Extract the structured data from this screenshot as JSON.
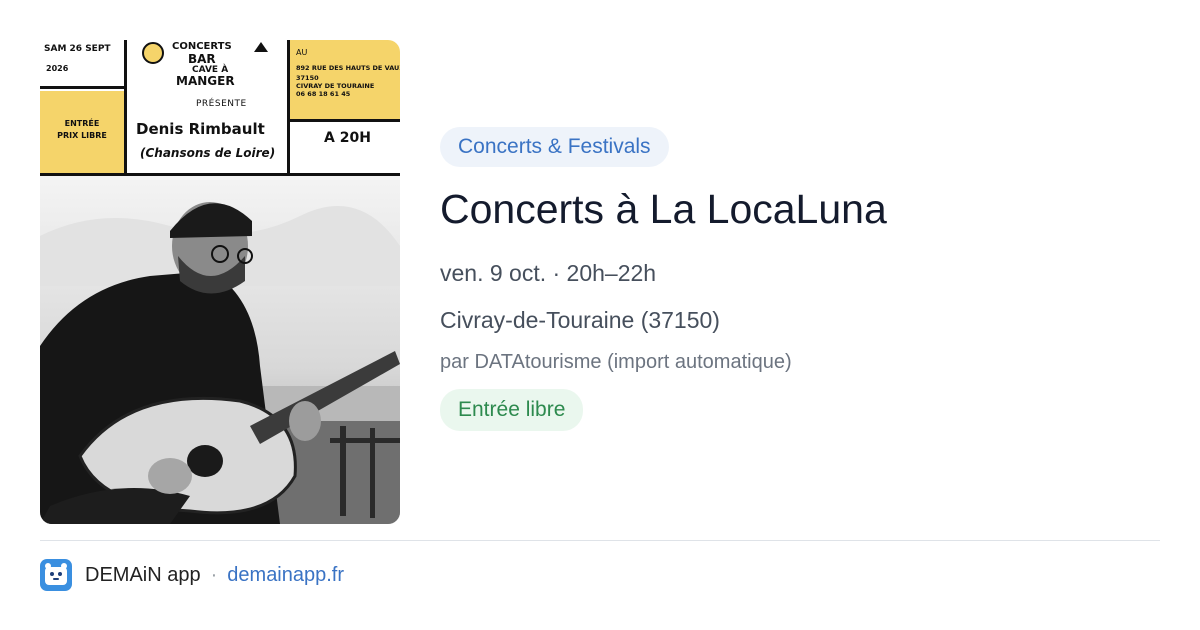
{
  "event_card": {
    "category": "Concerts & Festivals",
    "title": "Concerts à La LocaLuna",
    "datetime": "ven. 9 oct. · 20h–22h",
    "location": "Civray-de-Touraine (37150)",
    "source": "par DATAtourisme (import automatique)",
    "price": "Entrée libre"
  },
  "poster": {
    "date_line1": "SAM 26 SEPT",
    "date_line2": "2026",
    "logo_line1": "CONCERTS",
    "logo_line2": "BAR",
    "logo_line3": "CAVE À",
    "logo_line4": "MANGER",
    "presents": "PRÉSENTE",
    "artist": "Denis Rimbault",
    "subtitle": "(Chansons de Loire)",
    "entry_line1": "ENTRÉE",
    "entry_line2": "PRIX LIBRE",
    "at_label": "AU",
    "address_line1": "892 RUE DES HAUTS DE VAUX",
    "address_line2": "37150",
    "address_line3": "CIVRAY DE TOURAINE",
    "phone": "06 68 18 61 45",
    "time": "A 20H"
  },
  "footer": {
    "app_name": "DEMAiN app",
    "separator": "·",
    "url": "demainapp.fr"
  },
  "colors": {
    "chip_bg": "#eef3fa",
    "chip_text": "#3a73c4",
    "price_bg": "#eaf7ee",
    "price_text": "#2d8a4e",
    "poster_yellow": "#f5d46a"
  }
}
